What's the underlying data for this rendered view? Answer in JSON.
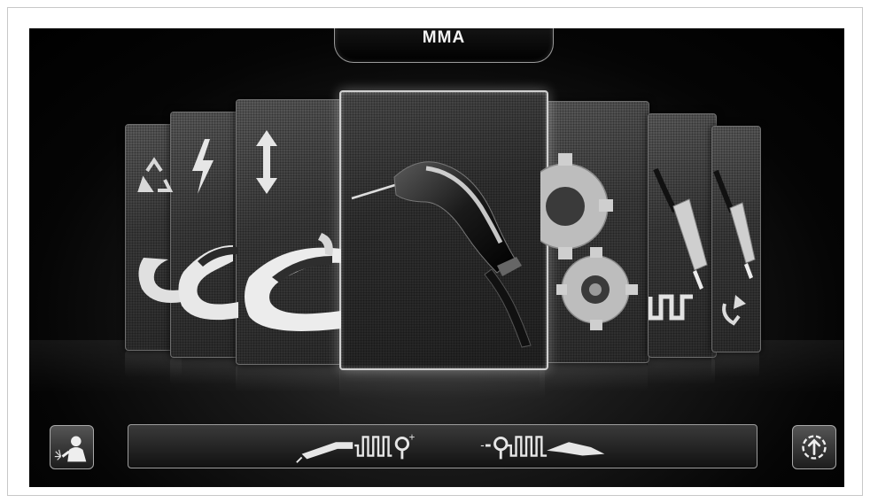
{
  "header": {
    "mode_label": "MMA"
  },
  "carousel": {
    "selected_index": 3,
    "cards": [
      {
        "id": "recycle-tool",
        "icon": "recycle-icon"
      },
      {
        "id": "power-tool",
        "icon": "lightning-icon"
      },
      {
        "id": "updown-tool",
        "icon": "up-down-arrow-icon"
      },
      {
        "id": "mma-electrode-holder",
        "icon": "electrode-holder-icon"
      },
      {
        "id": "settings",
        "icon": "gears-icon"
      },
      {
        "id": "tig-pulse",
        "icon": "tig-torch-pulse-icon"
      },
      {
        "id": "tig-recycle",
        "icon": "tig-torch-recycle-icon"
      }
    ]
  },
  "footer": {
    "left_button_icon": "welder-icon",
    "right_button_icon": "upload-circle-icon",
    "polarity": {
      "left_sign": "+",
      "right_sign": "-"
    }
  },
  "colors": {
    "screen_bg": "#000000",
    "card_border_selected": "#cfcfcf"
  }
}
